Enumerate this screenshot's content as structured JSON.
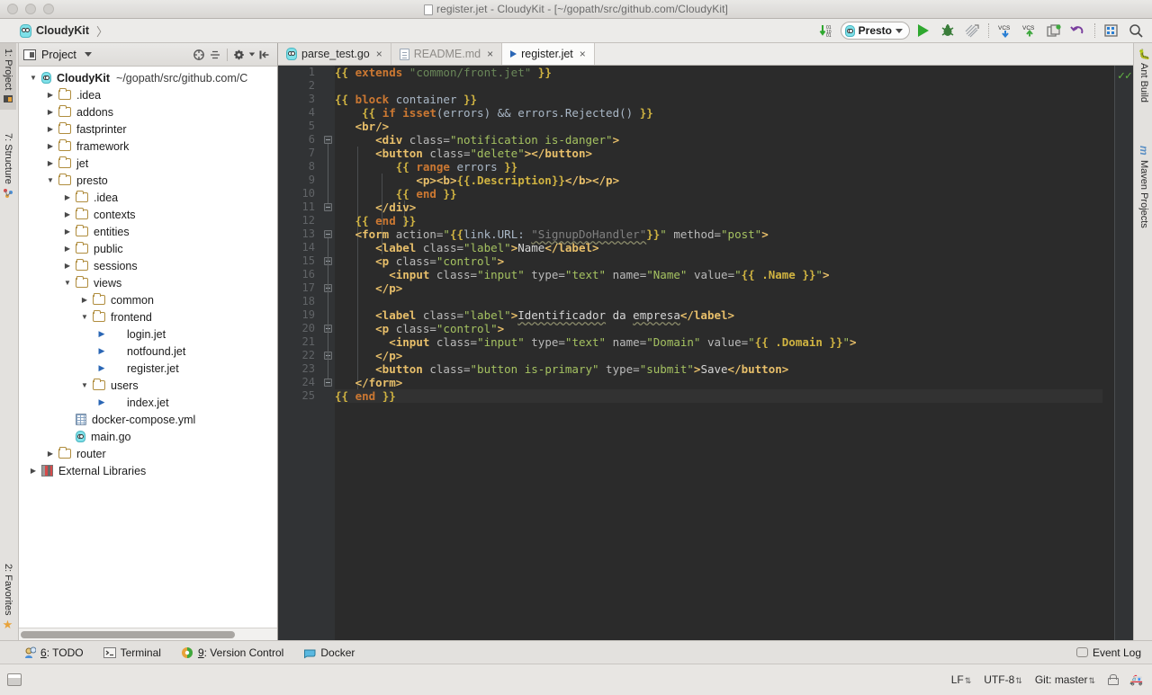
{
  "window": {
    "title": "register.jet - CloudyKit - [~/gopath/src/github.com/CloudyKit]"
  },
  "breadcrumb": {
    "project": "CloudyKit",
    "separator": "〉"
  },
  "toolbar": {
    "items": [
      {
        "name": "update-project-icon",
        "glyph": "↓",
        "label": ""
      },
      {
        "name": "run-configuration-selector",
        "label": "Presto"
      },
      {
        "name": "run-button",
        "label": ""
      },
      {
        "name": "debug-button",
        "label": ""
      },
      {
        "name": "coverage-button",
        "label": ""
      },
      {
        "name": "vcs-update-icon",
        "label": "VCS"
      },
      {
        "name": "vcs-commit-icon",
        "label": "VCS"
      },
      {
        "name": "vcs-history-icon",
        "label": ""
      },
      {
        "name": "revert-icon",
        "label": "↶"
      },
      {
        "name": "settings-icon",
        "label": ""
      },
      {
        "name": "search-everywhere-icon",
        "label": "⌕"
      }
    ]
  },
  "left_strip": {
    "items": [
      {
        "name": "sidebar-item-project",
        "label": "1: Project",
        "active": true
      },
      {
        "name": "sidebar-item-structure",
        "label": "7: Structure",
        "active": false
      }
    ],
    "bottom": [
      {
        "name": "sidebar-item-favorites",
        "label": "2: Favorites"
      }
    ]
  },
  "right_strip": {
    "items": [
      {
        "name": "sidebar-item-ant-build",
        "label": "Ant Build"
      },
      {
        "name": "sidebar-item-maven-projects",
        "label": "Maven Projects"
      }
    ]
  },
  "project_panel": {
    "tab_label": "Project",
    "tools": [
      {
        "name": "collapse-all-icon",
        "glyph": "⊖"
      },
      {
        "name": "expand-all-icon",
        "glyph": "÷"
      },
      {
        "name": "settings-gear-icon",
        "glyph": "⚙"
      },
      {
        "name": "hide-panel-icon",
        "glyph": "⇤"
      }
    ],
    "tree": [
      {
        "label": "CloudyKit",
        "path": "~/gopath/src/github.com/C",
        "depth": 0,
        "icon": "gopher",
        "state": "expanded",
        "root": true
      },
      {
        "label": ".idea",
        "depth": 1,
        "icon": "folder",
        "state": "collapsed"
      },
      {
        "label": "addons",
        "depth": 1,
        "icon": "folder",
        "state": "collapsed"
      },
      {
        "label": "fastprinter",
        "depth": 1,
        "icon": "folder",
        "state": "collapsed"
      },
      {
        "label": "framework",
        "depth": 1,
        "icon": "folder",
        "state": "collapsed"
      },
      {
        "label": "jet",
        "depth": 1,
        "icon": "folder",
        "state": "collapsed"
      },
      {
        "label": "presto",
        "depth": 1,
        "icon": "folder",
        "state": "expanded"
      },
      {
        "label": ".idea",
        "depth": 2,
        "icon": "folder",
        "state": "collapsed"
      },
      {
        "label": "contexts",
        "depth": 2,
        "icon": "folder",
        "state": "collapsed"
      },
      {
        "label": "entities",
        "depth": 2,
        "icon": "folder",
        "state": "collapsed"
      },
      {
        "label": "public",
        "depth": 2,
        "icon": "folder",
        "state": "collapsed"
      },
      {
        "label": "sessions",
        "depth": 2,
        "icon": "folder",
        "state": "collapsed"
      },
      {
        "label": "views",
        "depth": 2,
        "icon": "folder",
        "state": "expanded"
      },
      {
        "label": "common",
        "depth": 3,
        "icon": "folder",
        "state": "collapsed"
      },
      {
        "label": "frontend",
        "depth": 3,
        "icon": "folder",
        "state": "expanded"
      },
      {
        "label": "login.jet",
        "depth": 4,
        "icon": "jet",
        "state": "leaf"
      },
      {
        "label": "notfound.jet",
        "depth": 4,
        "icon": "jet",
        "state": "leaf"
      },
      {
        "label": "register.jet",
        "depth": 4,
        "icon": "jet",
        "state": "leaf"
      },
      {
        "label": "users",
        "depth": 3,
        "icon": "folder",
        "state": "expanded"
      },
      {
        "label": "index.jet",
        "depth": 4,
        "icon": "jet",
        "state": "leaf"
      },
      {
        "label": "docker-compose.yml",
        "depth": 2,
        "icon": "yml",
        "state": "none"
      },
      {
        "label": "main.go",
        "depth": 2,
        "icon": "gopher",
        "state": "none"
      },
      {
        "label": "router",
        "depth": 1,
        "icon": "folder",
        "state": "collapsed"
      },
      {
        "label": "External Libraries",
        "depth": 0,
        "icon": "lib",
        "state": "collapsed"
      }
    ]
  },
  "editor": {
    "tabs": [
      {
        "label": "parse_test.go",
        "icon": "go-icon",
        "active": false,
        "muted": false
      },
      {
        "label": "README.md",
        "icon": "markdown-icon",
        "active": false,
        "muted": true
      },
      {
        "label": "register.jet",
        "icon": "jet-icon",
        "active": true,
        "muted": false
      }
    ],
    "line_count": 25,
    "lines": [
      {
        "n": 1,
        "segments": [
          {
            "t": "{{ ",
            "c": "ybrace"
          },
          {
            "t": "extends ",
            "c": "kw"
          },
          {
            "t": "\"common/front.jet\" ",
            "c": "str"
          },
          {
            "t": "}}",
            "c": "ybrace"
          }
        ]
      },
      {
        "n": 2,
        "segments": []
      },
      {
        "n": 3,
        "segments": [
          {
            "t": "{{ ",
            "c": "ybrace"
          },
          {
            "t": "block ",
            "c": "kw"
          },
          {
            "t": "container ",
            "c": "plain"
          },
          {
            "t": "}}",
            "c": "ybrace"
          }
        ]
      },
      {
        "n": 4,
        "segments": [
          {
            "t": "    ",
            "c": "plain"
          },
          {
            "t": "{{ ",
            "c": "ybrace"
          },
          {
            "t": "if isset",
            "c": "kw"
          },
          {
            "t": "(errors) && errors.Rejected() ",
            "c": "plain"
          },
          {
            "t": "}}",
            "c": "ybrace"
          }
        ]
      },
      {
        "n": 5,
        "segments": [
          {
            "t": "   ",
            "c": "plain"
          },
          {
            "t": "<br/>",
            "c": "tagname"
          }
        ]
      },
      {
        "n": 6,
        "segments": [
          {
            "t": "      ",
            "c": "plain"
          },
          {
            "t": "<div ",
            "c": "tagname"
          },
          {
            "t": "class=",
            "c": "attr"
          },
          {
            "t": "\"notification is-danger\"",
            "c": "strg"
          },
          {
            "t": ">",
            "c": "tagname"
          }
        ]
      },
      {
        "n": 7,
        "segments": [
          {
            "t": "      ",
            "c": "plain"
          },
          {
            "t": "<button ",
            "c": "tagname"
          },
          {
            "t": "class=",
            "c": "attr"
          },
          {
            "t": "\"delete\"",
            "c": "strg"
          },
          {
            "t": "></button>",
            "c": "tagname"
          }
        ]
      },
      {
        "n": 8,
        "segments": [
          {
            "t": "         ",
            "c": "plain"
          },
          {
            "t": "{{ ",
            "c": "ybrace"
          },
          {
            "t": "range ",
            "c": "kw"
          },
          {
            "t": "errors ",
            "c": "plain"
          },
          {
            "t": "}}",
            "c": "ybrace"
          }
        ]
      },
      {
        "n": 9,
        "segments": [
          {
            "t": "            ",
            "c": "plain"
          },
          {
            "t": "<p><b>",
            "c": "tagname"
          },
          {
            "t": "{{.Description}}",
            "c": "ybrace"
          },
          {
            "t": "</b></p>",
            "c": "tagname"
          }
        ]
      },
      {
        "n": 10,
        "segments": [
          {
            "t": "         ",
            "c": "plain"
          },
          {
            "t": "{{ ",
            "c": "ybrace"
          },
          {
            "t": "end ",
            "c": "kw"
          },
          {
            "t": "}}",
            "c": "ybrace"
          }
        ]
      },
      {
        "n": 11,
        "segments": [
          {
            "t": "      ",
            "c": "plain"
          },
          {
            "t": "</div>",
            "c": "tagname"
          }
        ]
      },
      {
        "n": 12,
        "segments": [
          {
            "t": "   ",
            "c": "plain"
          },
          {
            "t": "{{ ",
            "c": "ybrace"
          },
          {
            "t": "end ",
            "c": "kw"
          },
          {
            "t": "}}",
            "c": "ybrace"
          }
        ]
      },
      {
        "n": 13,
        "segments": [
          {
            "t": "   ",
            "c": "plain"
          },
          {
            "t": "<form ",
            "c": "tagname"
          },
          {
            "t": "action=",
            "c": "attr"
          },
          {
            "t": "\"",
            "c": "strg"
          },
          {
            "t": "{{",
            "c": "ybrace"
          },
          {
            "t": "link.URL: ",
            "c": "plain"
          },
          {
            "t": "\"SignupDoHandler\"",
            "c": "gray squig"
          },
          {
            "t": "}}",
            "c": "ybrace"
          },
          {
            "t": "\" ",
            "c": "strg"
          },
          {
            "t": "method=",
            "c": "attr"
          },
          {
            "t": "\"post\"",
            "c": "strg"
          },
          {
            "t": ">",
            "c": "tagname"
          }
        ]
      },
      {
        "n": 14,
        "segments": [
          {
            "t": "      ",
            "c": "plain"
          },
          {
            "t": "<label ",
            "c": "tagname"
          },
          {
            "t": "class=",
            "c": "attr"
          },
          {
            "t": "\"label\"",
            "c": "strg"
          },
          {
            "t": ">",
            "c": "tagname"
          },
          {
            "t": "Name",
            "c": "white"
          },
          {
            "t": "</label>",
            "c": "tagname"
          }
        ]
      },
      {
        "n": 15,
        "segments": [
          {
            "t": "      ",
            "c": "plain"
          },
          {
            "t": "<p ",
            "c": "tagname"
          },
          {
            "t": "class=",
            "c": "attr"
          },
          {
            "t": "\"control\"",
            "c": "strg"
          },
          {
            "t": ">",
            "c": "tagname"
          }
        ]
      },
      {
        "n": 16,
        "segments": [
          {
            "t": "        ",
            "c": "plain"
          },
          {
            "t": "<input ",
            "c": "tagname"
          },
          {
            "t": "class=",
            "c": "attr"
          },
          {
            "t": "\"input\" ",
            "c": "strg"
          },
          {
            "t": "type=",
            "c": "attr"
          },
          {
            "t": "\"text\" ",
            "c": "strg"
          },
          {
            "t": "name=",
            "c": "attr"
          },
          {
            "t": "\"Name\" ",
            "c": "strg"
          },
          {
            "t": "value=",
            "c": "attr"
          },
          {
            "t": "\"",
            "c": "strg"
          },
          {
            "t": "{{ .Name }}",
            "c": "ybrace"
          },
          {
            "t": "\"",
            "c": "strg"
          },
          {
            "t": ">",
            "c": "tagname"
          }
        ]
      },
      {
        "n": 17,
        "segments": [
          {
            "t": "      ",
            "c": "plain"
          },
          {
            "t": "</p>",
            "c": "tagname"
          }
        ]
      },
      {
        "n": 18,
        "segments": []
      },
      {
        "n": 19,
        "segments": [
          {
            "t": "      ",
            "c": "plain"
          },
          {
            "t": "<label ",
            "c": "tagname"
          },
          {
            "t": "class=",
            "c": "attr"
          },
          {
            "t": "\"label\"",
            "c": "strg"
          },
          {
            "t": ">",
            "c": "tagname"
          },
          {
            "t": "Identificador",
            "c": "white squig"
          },
          {
            "t": " da ",
            "c": "white"
          },
          {
            "t": "empresa",
            "c": "white squig"
          },
          {
            "t": "</label>",
            "c": "tagname"
          }
        ]
      },
      {
        "n": 20,
        "segments": [
          {
            "t": "      ",
            "c": "plain"
          },
          {
            "t": "<p ",
            "c": "tagname"
          },
          {
            "t": "class=",
            "c": "attr"
          },
          {
            "t": "\"control\"",
            "c": "strg"
          },
          {
            "t": ">",
            "c": "tagname"
          }
        ]
      },
      {
        "n": 21,
        "segments": [
          {
            "t": "        ",
            "c": "plain"
          },
          {
            "t": "<input ",
            "c": "tagname"
          },
          {
            "t": "class=",
            "c": "attr"
          },
          {
            "t": "\"input\" ",
            "c": "strg"
          },
          {
            "t": "type=",
            "c": "attr"
          },
          {
            "t": "\"text\" ",
            "c": "strg"
          },
          {
            "t": "name=",
            "c": "attr"
          },
          {
            "t": "\"Domain\" ",
            "c": "strg"
          },
          {
            "t": "value=",
            "c": "attr"
          },
          {
            "t": "\"",
            "c": "strg"
          },
          {
            "t": "{{ .Domain }}",
            "c": "ybrace"
          },
          {
            "t": "\"",
            "c": "strg"
          },
          {
            "t": ">",
            "c": "tagname"
          }
        ]
      },
      {
        "n": 22,
        "segments": [
          {
            "t": "      ",
            "c": "plain"
          },
          {
            "t": "</p>",
            "c": "tagname"
          }
        ]
      },
      {
        "n": 23,
        "segments": [
          {
            "t": "      ",
            "c": "plain"
          },
          {
            "t": "<button ",
            "c": "tagname"
          },
          {
            "t": "class=",
            "c": "attr"
          },
          {
            "t": "\"button is-primary\" ",
            "c": "strg"
          },
          {
            "t": "type=",
            "c": "attr"
          },
          {
            "t": "\"submit\"",
            "c": "strg"
          },
          {
            "t": ">",
            "c": "tagname"
          },
          {
            "t": "Save",
            "c": "white"
          },
          {
            "t": "</button>",
            "c": "tagname"
          }
        ]
      },
      {
        "n": 24,
        "segments": [
          {
            "t": "   ",
            "c": "plain"
          },
          {
            "t": "</form>",
            "c": "tagname"
          }
        ]
      },
      {
        "n": 25,
        "segments": [
          {
            "t": "{{ ",
            "c": "ybrace"
          },
          {
            "t": "end ",
            "c": "kw"
          },
          {
            "t": "}}",
            "c": "ybrace"
          }
        ]
      }
    ],
    "inspection_status": "ok"
  },
  "bottom_bar": {
    "tools": [
      {
        "name": "tool-window-todo",
        "num": "6",
        "label": ": TODO",
        "color": "#e8b33a"
      },
      {
        "name": "tool-window-terminal",
        "num": "",
        "label": "Terminal",
        "color": "#8e8b87"
      },
      {
        "name": "tool-window-version-control",
        "num": "9",
        "label": ": Version Control",
        "color": "#e07b28"
      },
      {
        "name": "tool-window-docker",
        "num": "",
        "label": "Docker",
        "color": "#4aa8d8"
      }
    ],
    "event_log": "Event Log"
  },
  "status_bar": {
    "line_separator": "LF",
    "encoding": "UTF-8",
    "branch": "Git: master",
    "arrows": "⇅"
  },
  "colors": {
    "editor_bg": "#2b2b2b",
    "gutter_bg": "#313335",
    "accent_green": "#62b543",
    "keyword_orange": "#cc7832",
    "string_green": "#a5c261",
    "brace_yellow": "#d0b341",
    "tag_gold": "#e8bf6a",
    "chrome_bg": "#e3e1de"
  }
}
